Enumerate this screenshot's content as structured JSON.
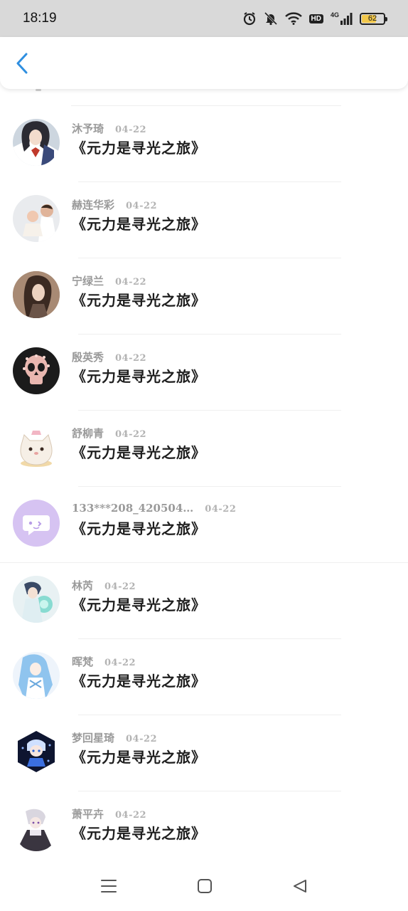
{
  "status_bar": {
    "time": "18:19",
    "battery_level": "62",
    "network_label": "4G",
    "hd_label": "HD"
  },
  "header": {
    "back_icon": "chevron-left-icon",
    "accent_color": "#2f8fe0"
  },
  "list": {
    "items": [
      {
        "name": "沐予琦",
        "date": "04-22",
        "title": "《元力是寻光之旅》",
        "avatar": "anime-girl-avatar"
      },
      {
        "name": "赫连华彩",
        "date": "04-22",
        "title": "《元力是寻光之旅》",
        "avatar": "parent-child-photo-avatar"
      },
      {
        "name": "宁绿兰",
        "date": "04-22",
        "title": "《元力是寻光之旅》",
        "avatar": "woman-portrait-avatar"
      },
      {
        "name": "殷英秀",
        "date": "04-22",
        "title": "《元力是寻光之旅》",
        "avatar": "floral-skull-avatar"
      },
      {
        "name": "舒柳青",
        "date": "04-22",
        "title": "《元力是寻光之旅》",
        "avatar": "cartoon-cat-avatar"
      },
      {
        "name": "133***208_420504…",
        "date": "04-22",
        "title": "《元力是寻光之旅》",
        "avatar": "default-chat-avatar"
      },
      {
        "name": "林芮",
        "date": "04-22",
        "title": "《元力是寻光之旅》",
        "avatar": "anime-character-orb-avatar"
      },
      {
        "name": "晖梵",
        "date": "04-22",
        "title": "《元力是寻光之旅》",
        "avatar": "blue-hair-anime-avatar"
      },
      {
        "name": "梦回星琦",
        "date": "04-22",
        "title": "《元力是寻光之旅》",
        "avatar": "chibi-dark-hexagon-avatar"
      },
      {
        "name": "萧平卉",
        "date": "04-22",
        "title": "《元力是寻光之旅》",
        "avatar": "chibi-white-hair-avatar"
      }
    ]
  },
  "nav_bar": {
    "menu_icon": "menu-icon",
    "home_icon": "home-icon",
    "back_icon": "back-triangle-icon"
  }
}
